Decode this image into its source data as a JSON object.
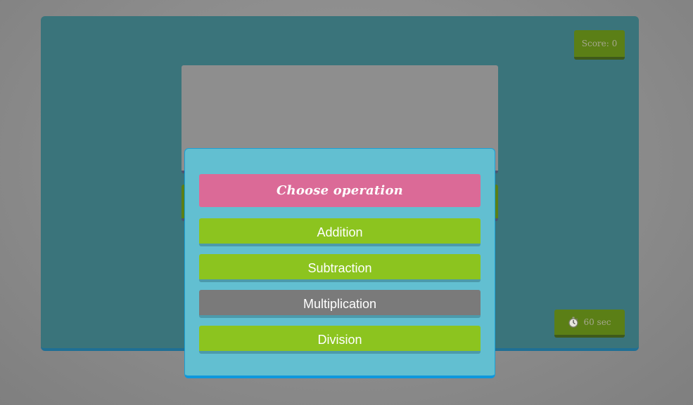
{
  "game": {
    "score_text": "Score: 0",
    "timer_text": "60 sec",
    "timer_icon": "stopwatch-icon"
  },
  "modal": {
    "title": "Choose operation",
    "operations": [
      {
        "label": "Addition",
        "state": "enabled"
      },
      {
        "label": "Subtraction",
        "state": "enabled"
      },
      {
        "label": "Multiplication",
        "state": "disabled"
      },
      {
        "label": "Division",
        "state": "enabled"
      }
    ]
  },
  "colors": {
    "board": "#3a747b",
    "modal": "#62bfd1",
    "title_bar": "#db6a97",
    "operation_enabled": "#8cc41f",
    "operation_disabled": "#7a7a7a",
    "badge": "#5b7f16"
  }
}
